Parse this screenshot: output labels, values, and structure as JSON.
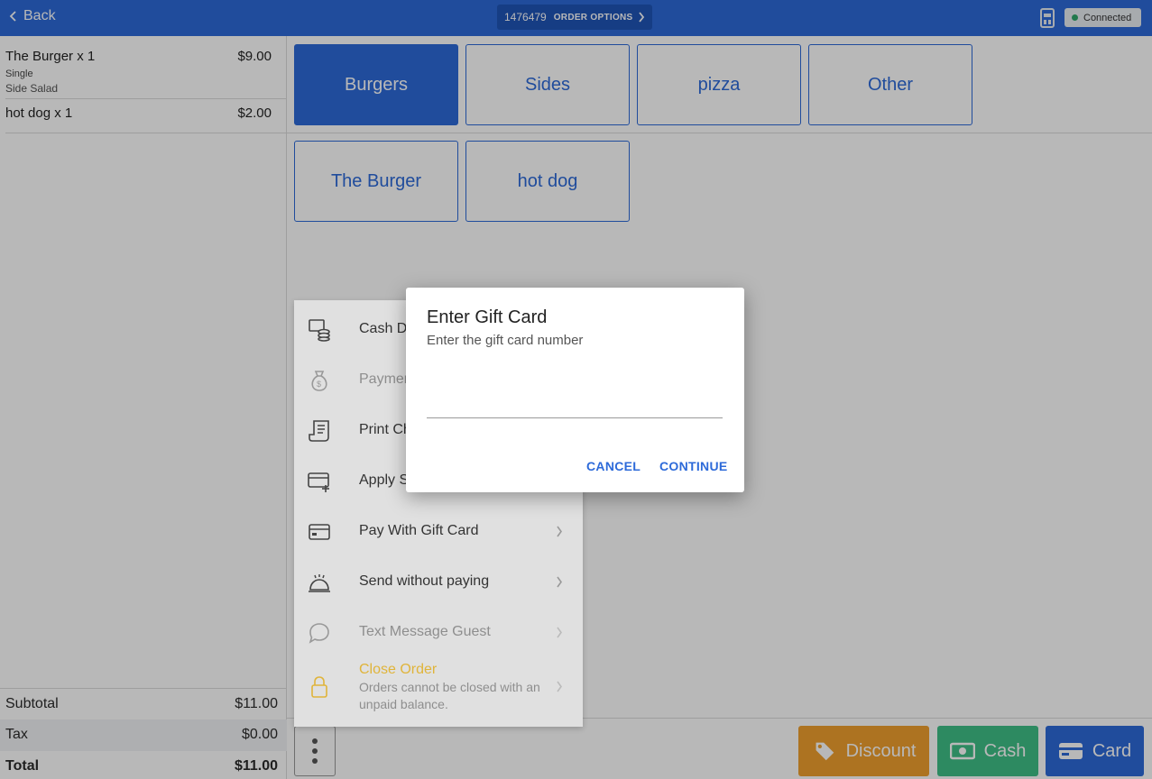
{
  "topbar": {
    "back_label": "Back",
    "order_number": "1476479",
    "order_options_label": "ORDER OPTIONS",
    "status_label": "Connected",
    "status_color": "#2ea86a"
  },
  "order": {
    "items": [
      {
        "name": "The Burger x 1",
        "price": "$9.00",
        "modifiers": [
          "Single",
          "Side Salad"
        ]
      },
      {
        "name": "hot dog x 1",
        "price": "$2.00",
        "modifiers": []
      }
    ],
    "subtotal_label": "Subtotal",
    "subtotal_value": "$11.00",
    "tax_label": "Tax",
    "tax_value": "$0.00",
    "total_label": "Total",
    "total_value": "$11.00"
  },
  "categories": [
    {
      "label": "Burgers",
      "active": true
    },
    {
      "label": "Sides",
      "active": false
    },
    {
      "label": "pizza",
      "active": false
    },
    {
      "label": "Other",
      "active": false
    }
  ],
  "products": [
    {
      "label": "The Burger"
    },
    {
      "label": "hot dog"
    }
  ],
  "actions": {
    "discount_label": "Discount",
    "cash_label": "Cash",
    "card_label": "Card",
    "discount_color": "#f0a02e",
    "cash_color": "#3fbf87",
    "card_color": "#2d6ad9"
  },
  "menu": {
    "items": [
      {
        "label": "Cash D",
        "icon": "cash-drawer-icon",
        "disabled": false
      },
      {
        "label": "Paymen",
        "icon": "money-bag-icon",
        "disabled": true
      },
      {
        "label": "Print Ch",
        "icon": "receipt-icon",
        "disabled": false
      },
      {
        "label": "Apply S",
        "icon": "card-plus-icon",
        "disabled": false
      },
      {
        "label": "Pay With Gift Card",
        "icon": "gift-card-icon",
        "disabled": false
      },
      {
        "label": "Send without paying",
        "icon": "service-bell-icon",
        "disabled": false
      },
      {
        "label": "Text Message Guest",
        "icon": "chat-bubble-icon",
        "disabled": true
      },
      {
        "label": "Close Order",
        "sublabel": "Orders cannot be closed with an unpaid balance.",
        "icon": "lock-icon",
        "disabled": true
      }
    ]
  },
  "dialog": {
    "title": "Enter Gift Card",
    "subtitle": "Enter the gift card number",
    "input_value": "",
    "input_placeholder": "",
    "cancel_label": "CANCEL",
    "continue_label": "CONTINUE"
  }
}
